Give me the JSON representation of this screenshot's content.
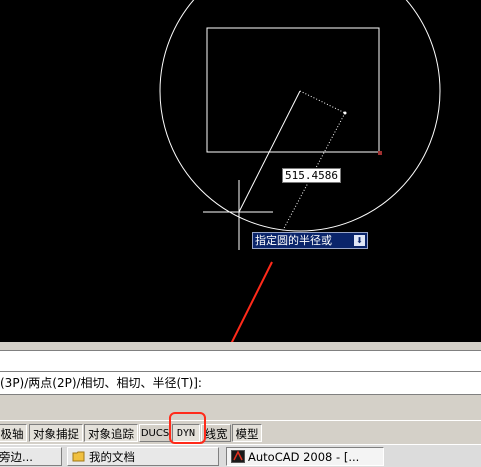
{
  "drawing": {
    "radius_input_value": "515.4586",
    "prompt_tooltip": "指定圆的半径或",
    "dropdown_glyph": "⬇"
  },
  "command_line": {
    "text": "(3P)/两点(2P)/相切、相切、半径(T)]:"
  },
  "status_bar": {
    "buttons": [
      {
        "label": "极轴",
        "state": "on"
      },
      {
        "label": "对象捕捉",
        "state": "on"
      },
      {
        "label": "对象追踪",
        "state": "on"
      },
      {
        "label": "DUCS",
        "state": "off"
      },
      {
        "label": "DYN",
        "state": "on"
      },
      {
        "label": "线宽",
        "state": "off"
      },
      {
        "label": "模型",
        "state": "on"
      }
    ]
  },
  "taskbar": {
    "items": [
      {
        "label": "旁边...",
        "icon": "window-icon"
      },
      {
        "label": "我的文档",
        "icon": "folder-icon"
      },
      {
        "label": "AutoCAD 2008 - [...",
        "icon": "autocad-icon"
      }
    ]
  },
  "colors": {
    "canvas_bg": "#000000",
    "highlight_red": "#ff2a1a",
    "tooltip_bg": "#0a246a"
  }
}
